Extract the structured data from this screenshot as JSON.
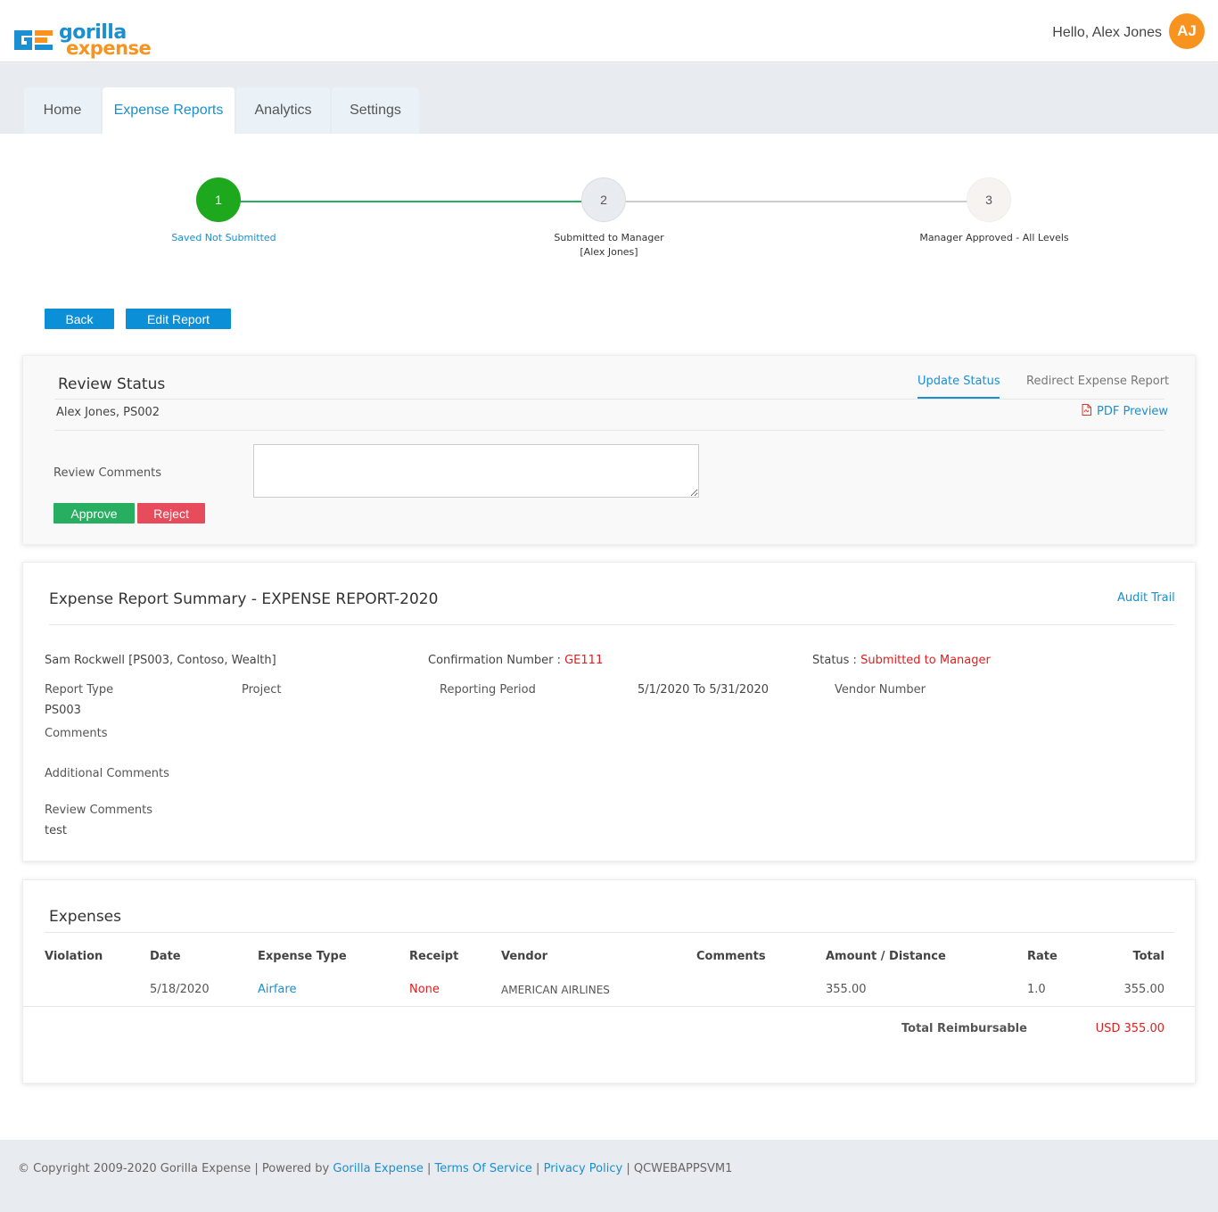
{
  "header": {
    "logo_top": "gorilla",
    "logo_bottom": "expense",
    "greeting": "Hello, Alex Jones",
    "avatar_initials": "AJ"
  },
  "nav": {
    "tabs": [
      {
        "label": "Home"
      },
      {
        "label": "Expense Reports"
      },
      {
        "label": "Analytics"
      },
      {
        "label": "Settings"
      }
    ]
  },
  "stepper": {
    "steps": [
      {
        "number": "1",
        "label": "Saved Not Submitted",
        "sub": ""
      },
      {
        "number": "2",
        "label": "Submitted to Manager",
        "sub": "[Alex Jones]"
      },
      {
        "number": "3",
        "label": "Manager Approved - All Levels",
        "sub": ""
      }
    ]
  },
  "actions": {
    "back_label": "Back",
    "edit_label": "Edit Report"
  },
  "review": {
    "title": "Review Status",
    "update_status": "Update Status",
    "redirect": "Redirect Expense Report",
    "user": "Alex Jones, PS002",
    "pdf_preview": "PDF Preview",
    "comments_label": "Review Comments",
    "comments_value": "",
    "approve_label": "Approve",
    "reject_label": "Reject"
  },
  "summary": {
    "title": "Expense Report Summary - EXPENSE REPORT-2020",
    "audit_trail": "Audit Trail",
    "employee": "Sam Rockwell [PS003, Contoso, Wealth]",
    "confirmation_label": "Confirmation Number : ",
    "confirmation_value": "GE111",
    "status_label": "Status : ",
    "status_value": "Submitted to Manager",
    "report_type_label": "Report Type",
    "report_type_value": "PS003",
    "project_label": "Project",
    "reporting_period_label": "Reporting Period",
    "reporting_period_value": "5/1/2020 To 5/31/2020",
    "vendor_number_label": "Vendor Number",
    "comments_label": "Comments",
    "additional_comments_label": "Additional Comments",
    "review_comments_label": "Review Comments",
    "review_comments_value": "test"
  },
  "expenses": {
    "title": "Expenses",
    "columns": [
      "Violation",
      "Date",
      "Expense Type",
      "Receipt",
      "Vendor",
      "Comments",
      "Amount / Distance",
      "Rate",
      "Total"
    ],
    "rows": [
      {
        "violation": "",
        "date": "5/18/2020",
        "expense_type": "Airfare",
        "receipt": "None",
        "vendor": "AMERICAN AIRLINES",
        "comments": "",
        "amount": "355.00",
        "rate": "1.0",
        "total": "355.00"
      }
    ],
    "total_label": "Total Reimbursable",
    "total_value": "USD 355.00"
  },
  "footer": {
    "copyright": "© Copyright 2009-2020 Gorilla Expense | Powered by ",
    "powered_link": "Gorilla Expense",
    "sep1": " | ",
    "terms": "Terms Of Service",
    "sep2": " | ",
    "privacy": "Privacy Policy",
    "sep3": " | ",
    "server": "QCWEBAPPSVM1"
  },
  "colors": {
    "brand_blue": "#1a8fd1",
    "brand_orange": "#f7931e",
    "step_active": "#1ea81e",
    "approve": "#27ae60",
    "reject": "#e74c5c",
    "status_red": "#e21d1d"
  }
}
